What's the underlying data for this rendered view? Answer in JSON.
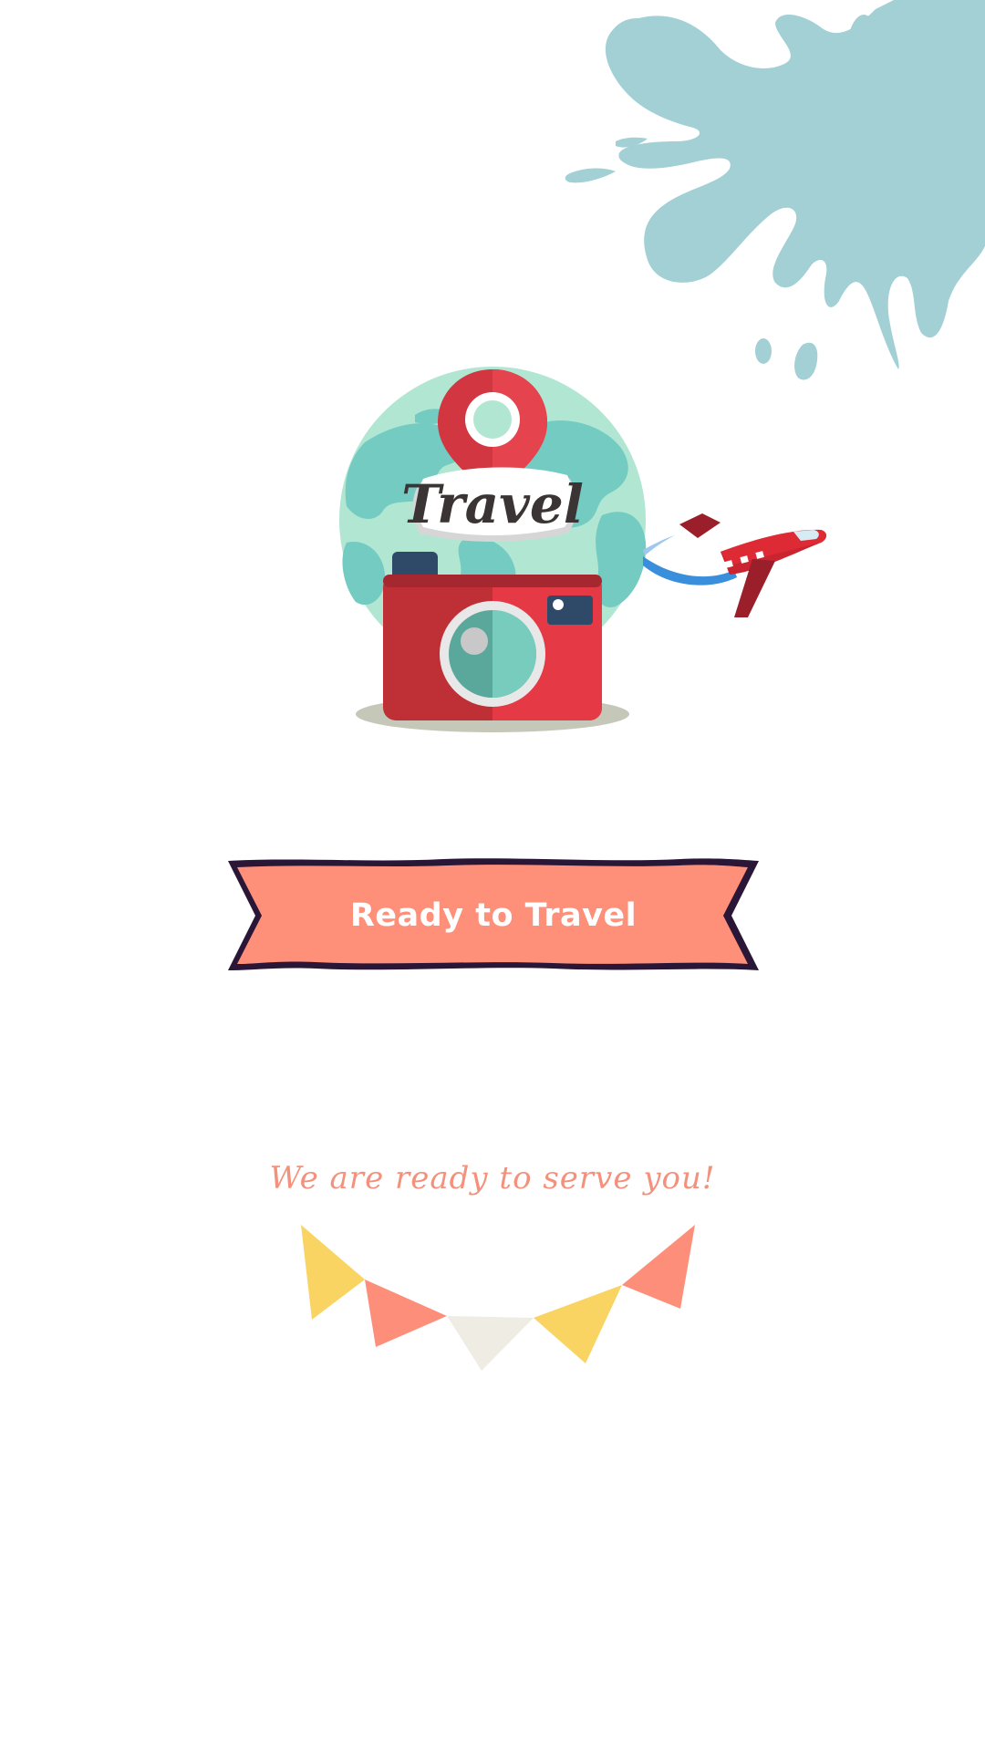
{
  "illustration": {
    "badge_text": "Travel"
  },
  "banner": {
    "label": "Ready to Travel"
  },
  "tagline": {
    "text": "We are ready to serve you!"
  },
  "colors": {
    "background": "#ffffff",
    "splash": "#a2d0d5",
    "banner_fill": "#fe8f79",
    "banner_border": "#2a1637",
    "tagline": "#f4917c",
    "camera_red": "#e53a45",
    "globe": "#74cbc1",
    "bunting_yellow": "#f9d462",
    "bunting_salmon": "#fd8f7a",
    "bunting_cream": "#efede3"
  },
  "icons": [
    "paint-splash-decoration",
    "globe-icon",
    "map-pin-icon",
    "camera-icon",
    "airplane-icon",
    "bunting-flags-decoration"
  ]
}
